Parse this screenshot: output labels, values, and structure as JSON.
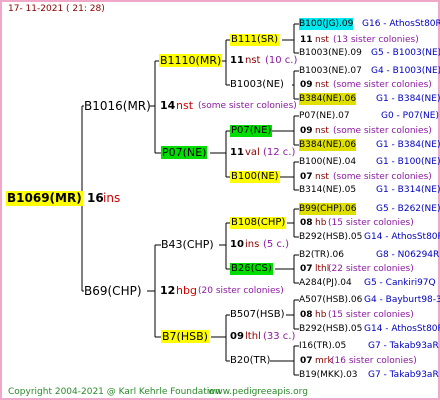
{
  "date": "17- 11-2021 ( 21: 28)",
  "footer_copyright": "Copyright 2004-2021 @ Karl Kehrle Foundation",
  "footer_url": "www.pedigreeapis.org",
  "root": {
    "label": "B1069(MR)",
    "num": "16",
    "suffix": "ins"
  },
  "gen1": [
    {
      "label": "B1016(MR)",
      "num": "14",
      "suffix": "nst",
      "note": "(some sister colonies)"
    },
    {
      "label": "B69(CHP)",
      "num": "12",
      "suffix": "hbg",
      "note": "(20 sister colonies)"
    }
  ],
  "gen2": [
    {
      "label": "B1110(MR)",
      "num": "11",
      "suffix": "nst",
      "note": "(10 c.)"
    },
    {
      "label": "P07(NE)",
      "num": "11",
      "suffix": "val",
      "note": "(12 c.)"
    },
    {
      "label": "B43(CHP)",
      "num": "10",
      "suffix": "ins",
      "note": "(5 c.)"
    },
    {
      "label": "B7(HSB)",
      "num": "09",
      "suffix": "lthl",
      "note": "(33 c.)"
    }
  ],
  "gen3": [
    {
      "label": "B111(SR)",
      "num": "11",
      "suffix": "nst",
      "note": "(13 sister colonies)"
    },
    {
      "label": "B1003(NE)",
      "num": "09",
      "suffix": "nst",
      "note": "(some sister colonies)"
    },
    {
      "label": "P07(NE)",
      "num": "09",
      "suffix": "nst",
      "note": "(some sister colonies)"
    },
    {
      "label": "B100(NE)",
      "num": "07",
      "suffix": "nst",
      "note": "(some sister colonies)"
    },
    {
      "label": "B108(CHP)",
      "num": "08",
      "suffix": "hb",
      "note": "(15 sister colonies)"
    },
    {
      "label": "B26(CS)",
      "num": "07",
      "suffix": "lthl",
      "note": "(22 sister colonies)"
    },
    {
      "label": "B507(HSB)",
      "num": "08",
      "suffix": "hb",
      "note": "(15 sister colonies)"
    },
    {
      "label": "B20(TR)",
      "num": "07",
      "suffix": "mrk",
      "note": "(16 sister colonies)"
    }
  ],
  "gen4": [
    {
      "label": "B100(JG).09",
      "right": "G16 - AthosSt80R"
    },
    {
      "label": "B1003(NE).09",
      "right": "G5 - B1003(NE)"
    },
    {
      "label": "B1003(NE).07",
      "right": "G4 - B1003(NE)"
    },
    {
      "label": "B384(NE).06",
      "right": "G1 - B384(NE)"
    },
    {
      "label": "P07(NE).07",
      "right": "G0 - P07(NE)"
    },
    {
      "label": "B384(NE).06",
      "right": "G1 - B384(NE)"
    },
    {
      "label": "B100(NE).04",
      "right": "G1 - B100(NE)"
    },
    {
      "label": "B314(NE).05",
      "right": "G1 - B314(NE)"
    },
    {
      "label": "B99(CHP).06",
      "right": "G5 - B262(NE)"
    },
    {
      "label": "B292(HSB).05",
      "right": "G14 - AthosSt80R"
    },
    {
      "label": "B2(TR).06",
      "right": "G8 - N06294R"
    },
    {
      "label": "A284(PJ).04",
      "right": "G5 - Cankiri97Q"
    },
    {
      "label": "A507(HSB).06",
      "right": "G4 - Bayburt98-3"
    },
    {
      "label": "B292(HSB).05",
      "right": "G14 - AthosSt80R"
    },
    {
      "label": "I16(TR).05",
      "right": "G7 - Takab93aR"
    },
    {
      "label": "B19(MKK).03",
      "right": "G7 - Takab93aR"
    }
  ],
  "colors": {
    "line": "#000000",
    "border": "#f0a8c8",
    "footer": "#2a8a2a",
    "annotation": "#8a0000"
  }
}
